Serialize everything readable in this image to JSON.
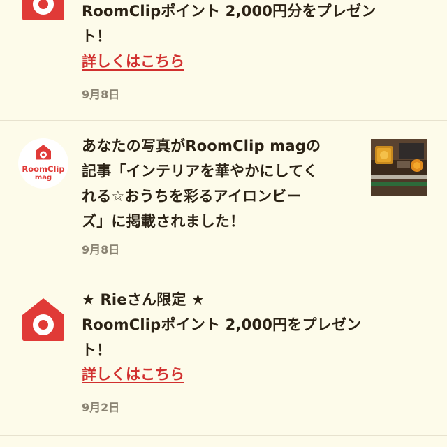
{
  "notifications": [
    {
      "icon": "roomclip-house-icon",
      "lines": [
        "RoomClipポイント 2,000円分をプレゼン",
        "ト！"
      ],
      "link_label": "詳しくはこちら",
      "date": "9月8日"
    },
    {
      "icon": "roomclip-mag-logo",
      "logo_text_top": "RoomClip",
      "logo_text_bottom": "mag",
      "lines": [
        "あなたの写真がRoomClip magの",
        "記事「インテリアを華やかにしてく",
        "れる☆おうちを彩るアイロンビー",
        "ズ」に掲載されました！"
      ],
      "date": "9月8日",
      "has_thumbnail": true
    },
    {
      "icon": "roomclip-house-icon",
      "lines": [
        "★ Rieさん限定 ★",
        "RoomClipポイント 2,000円をプレゼン",
        "ト！"
      ],
      "link_label": "詳しくはこちら",
      "date": "9月2日"
    }
  ],
  "colors": {
    "background": "#fdfbea",
    "brand_red": "#e03a37",
    "link_red": "#d1302f",
    "text": "#2b2215",
    "date_gray": "#8a8373",
    "divider": "#e7e2cf"
  }
}
